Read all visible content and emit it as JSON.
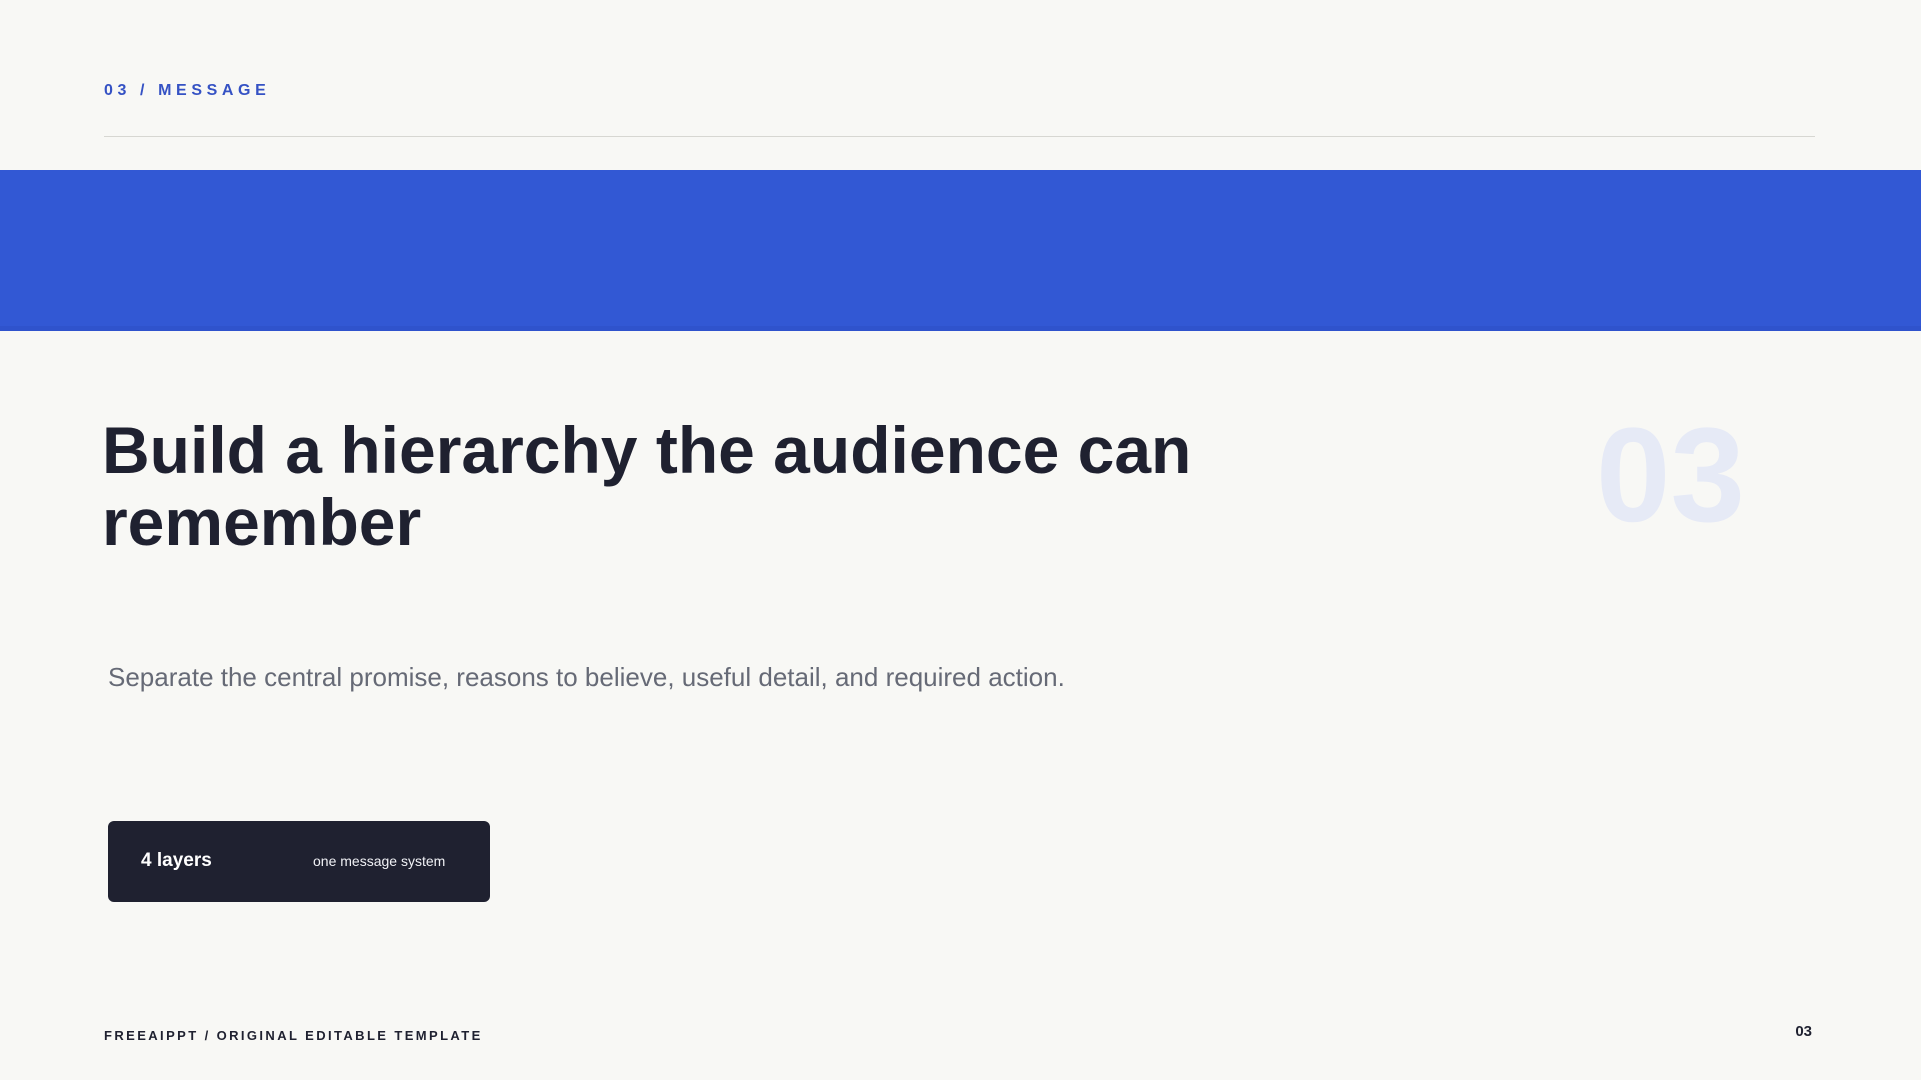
{
  "header": {
    "section_label": "03 / MESSAGE"
  },
  "colors": {
    "accent": "#3258d4",
    "dark": "#1f2130",
    "background": "#f8f8f5",
    "muted_text": "#666a76",
    "watermark_number": "#e6eaf6"
  },
  "slide": {
    "headline": "Build a hierarchy the audience can remember",
    "big_number": "03",
    "subtext": "Separate the central promise, reasons to believe, useful detail, and required action."
  },
  "stat_card": {
    "value": "4 layers",
    "caption": "one message system"
  },
  "footer": {
    "brand": "FREEAIPPT / ORIGINAL EDITABLE TEMPLATE",
    "page_number": "03"
  }
}
